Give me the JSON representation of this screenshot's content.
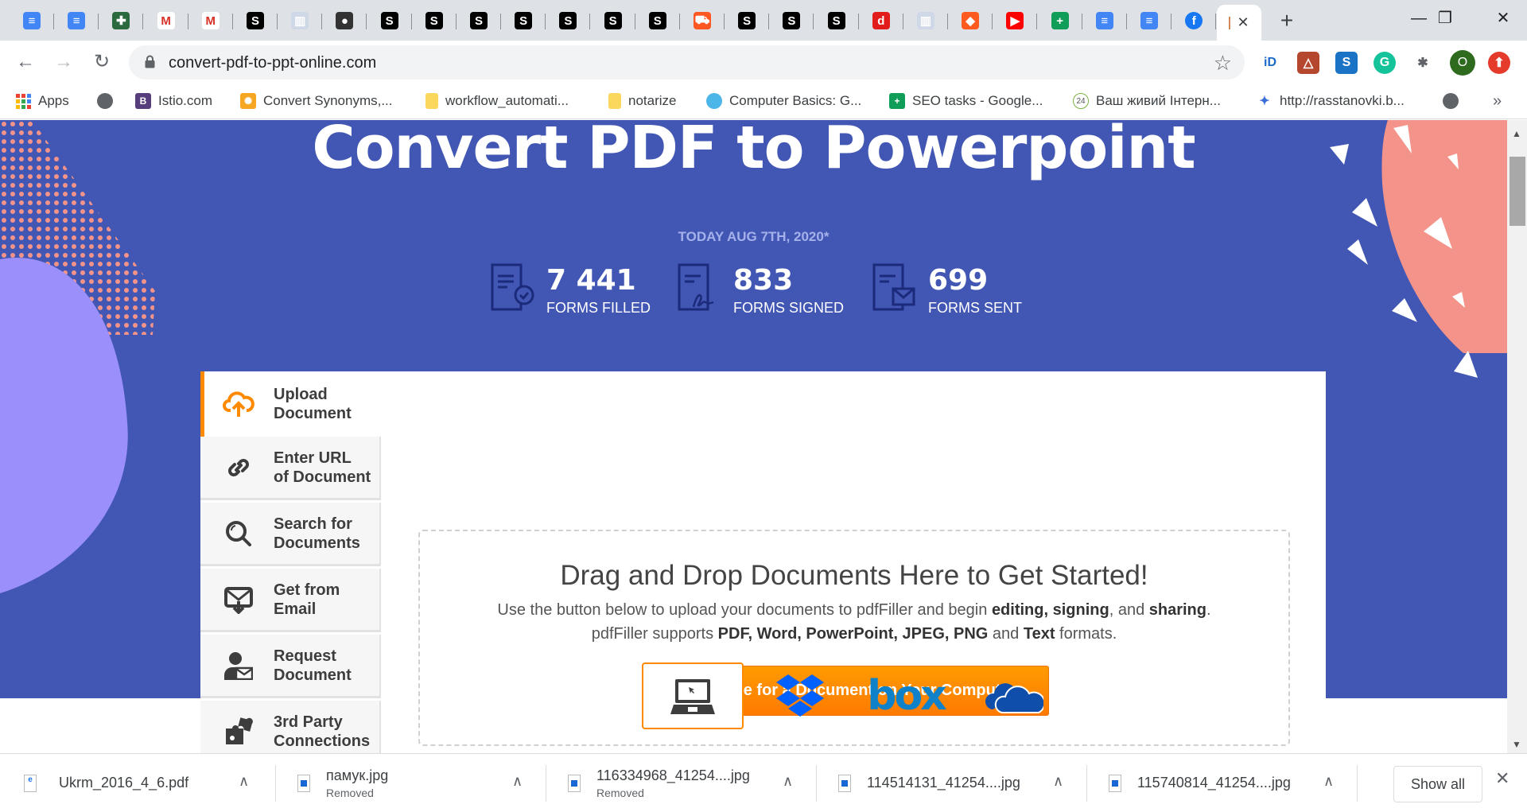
{
  "browser": {
    "tabs": [
      {
        "icon": "google-docs-icon",
        "color": "#4285f4",
        "glyph": "≡"
      },
      {
        "icon": "google-docs-icon",
        "color": "#4285f4",
        "glyph": "≡"
      },
      {
        "icon": "cross-emblem-icon",
        "color": "#2b6a3e",
        "glyph": "✚"
      },
      {
        "icon": "gmail-icon",
        "color": "#ffffff",
        "glyph": "M"
      },
      {
        "icon": "gmail-icon",
        "color": "#ffffff",
        "glyph": "M"
      },
      {
        "icon": "s-icon",
        "color": "#000000",
        "glyph": "S"
      },
      {
        "icon": "books-icon",
        "color": "#cfd8e6",
        "glyph": "▥"
      },
      {
        "icon": "record-icon",
        "color": "#333333",
        "glyph": "●"
      },
      {
        "icon": "s-icon",
        "color": "#000000",
        "glyph": "S"
      },
      {
        "icon": "s-icon",
        "color": "#000000",
        "glyph": "S"
      },
      {
        "icon": "s-icon",
        "color": "#000000",
        "glyph": "S"
      },
      {
        "icon": "s-icon",
        "color": "#000000",
        "glyph": "S"
      },
      {
        "icon": "s-icon",
        "color": "#000000",
        "glyph": "S"
      },
      {
        "icon": "s-icon",
        "color": "#000000",
        "glyph": "S"
      },
      {
        "icon": "s-icon",
        "color": "#000000",
        "glyph": "S"
      },
      {
        "icon": "truck-icon",
        "color": "#ff5722",
        "glyph": "⛟"
      },
      {
        "icon": "s-icon",
        "color": "#000000",
        "glyph": "S"
      },
      {
        "icon": "s-icon",
        "color": "#000000",
        "glyph": "S"
      },
      {
        "icon": "s-icon",
        "color": "#000000",
        "glyph": "S"
      },
      {
        "icon": "d-icon",
        "color": "#e21b1b",
        "glyph": "d"
      },
      {
        "icon": "books-icon",
        "color": "#cfd8e6",
        "glyph": "▥"
      },
      {
        "icon": "australia-icon",
        "color": "#ff5a1f",
        "glyph": "◆"
      },
      {
        "icon": "youtube-icon",
        "color": "#ff0000",
        "glyph": "▶"
      },
      {
        "icon": "google-sheets-plus-icon",
        "color": "#0f9d58",
        "glyph": "+"
      },
      {
        "icon": "google-docs-icon",
        "color": "#4285f4",
        "glyph": "≡"
      },
      {
        "icon": "google-docs-icon",
        "color": "#4285f4",
        "glyph": "≡"
      },
      {
        "icon": "facebook-icon",
        "color": "#1877f2",
        "glyph": "f"
      }
    ],
    "active_tab_close": "✕",
    "new_tab": "+",
    "window": {
      "minimize": "—",
      "restore": "❐",
      "close": "✕"
    },
    "url": "convert-pdf-to-ppt-online.com",
    "extensions": [
      {
        "name": "id-extension-icon",
        "color": "#ffffff",
        "glyph": "iD",
        "fg": "#1b6ac9"
      },
      {
        "name": "triangle-extension-icon",
        "color": "#b5472f",
        "glyph": "△",
        "fg": "#fff"
      },
      {
        "name": "s-script-extension-icon",
        "color": "#1b73c6",
        "glyph": "S",
        "fg": "#fff"
      },
      {
        "name": "grammarly-icon",
        "color": "#15c39a",
        "glyph": "G",
        "fg": "#fff"
      },
      {
        "name": "puzzle-extensions-icon",
        "color": "#ffffff",
        "glyph": "✱",
        "fg": "#5f6368"
      },
      {
        "name": "profile-avatar",
        "color": "#2e6b1f",
        "glyph": "O",
        "fg": "#fff"
      },
      {
        "name": "update-arrow-icon",
        "color": "#e53b2c",
        "glyph": "⬆",
        "fg": "#fff"
      }
    ],
    "bookmarks": [
      {
        "label": "Apps",
        "icon": "apps-grid-icon"
      },
      {
        "label": "",
        "icon": "globe-icon"
      },
      {
        "label": "Istio.com",
        "icon": "bootstrap-b-icon"
      },
      {
        "label": "Convert Synonyms,...",
        "icon": "sunburst-icon"
      },
      {
        "label": "workflow_automati...",
        "icon": "folder-icon"
      },
      {
        "label": "notarize",
        "icon": "folder-icon"
      },
      {
        "label": "Computer Basics: G...",
        "icon": "gcf-globe-icon"
      },
      {
        "label": "SEO tasks - Google...",
        "icon": "google-sheets-plus-icon"
      },
      {
        "label": "Ваш живий Інтерн...",
        "icon": "24-badge-icon"
      },
      {
        "label": "http://rasstanovki.b...",
        "icon": "people-icon"
      },
      {
        "label": "",
        "icon": "globe-icon"
      }
    ],
    "bookmarks_overflow": "»"
  },
  "hero": {
    "title": "Convert PDF to Powerpoint",
    "date": "TODAY AUG 7TH, 2020*",
    "stats": [
      {
        "value": "7 441",
        "label": "FORMS FILLED",
        "icon": "form-check-icon"
      },
      {
        "value": "833",
        "label": "FORMS SIGNED",
        "icon": "form-signature-icon"
      },
      {
        "value": "699",
        "label": "FORMS SENT",
        "icon": "form-envelope-icon"
      }
    ]
  },
  "sidebar": {
    "items": [
      {
        "line1": "Upload",
        "line2": "Document",
        "icon": "cloud-upload-icon",
        "active": true
      },
      {
        "line1": "Enter URL",
        "line2": "of Document",
        "icon": "link-icon"
      },
      {
        "line1": "Search for",
        "line2": "Documents",
        "icon": "search-icon"
      },
      {
        "line1": "Get from",
        "line2": "Email",
        "icon": "email-download-icon"
      },
      {
        "line1": "Request",
        "line2": "Document",
        "icon": "person-mail-icon"
      },
      {
        "line1": "3rd Party",
        "line2": "Connections",
        "icon": "puzzle-icon"
      }
    ]
  },
  "dropzone": {
    "title": "Drag and Drop Documents Here to Get Started!",
    "line1_pre": "Use the button below to upload your documents to pdfFiller and begin ",
    "line1_b1": "editing, signing",
    "line1_mid": ", and ",
    "line1_b2": "sharing",
    "line1_end": ".",
    "line2_pre": "pdfFiller supports ",
    "line2_b1": "PDF, Word, PowerPoint, JPEG, PNG",
    "line2_mid": " and ",
    "line2_b2": "Text",
    "line2_end": " formats.",
    "button": "Browse for a Document on Your Computer",
    "accent": "#ff8a00"
  },
  "sources": [
    {
      "name": "my-computer-source",
      "selected": true
    },
    {
      "name": "dropbox-source"
    },
    {
      "name": "box-source",
      "label": "box"
    },
    {
      "name": "onedrive-source"
    }
  ],
  "downloads": {
    "items": [
      {
        "name": "Ukrm_2016_4_6.pdf",
        "status": ""
      },
      {
        "name": "памук.jpg",
        "status": "Removed"
      },
      {
        "name": "116334968_41254....jpg",
        "status": "Removed"
      },
      {
        "name": "114514131_41254....jpg",
        "status": ""
      },
      {
        "name": "115740814_41254....jpg",
        "status": ""
      }
    ],
    "show_all": "Show all",
    "close": "✕"
  },
  "colors": {
    "hero_bg": "#4257b4",
    "accent_orange": "#ff8a00",
    "salmon": "#f4938a",
    "lilac": "#9b8ffb"
  }
}
